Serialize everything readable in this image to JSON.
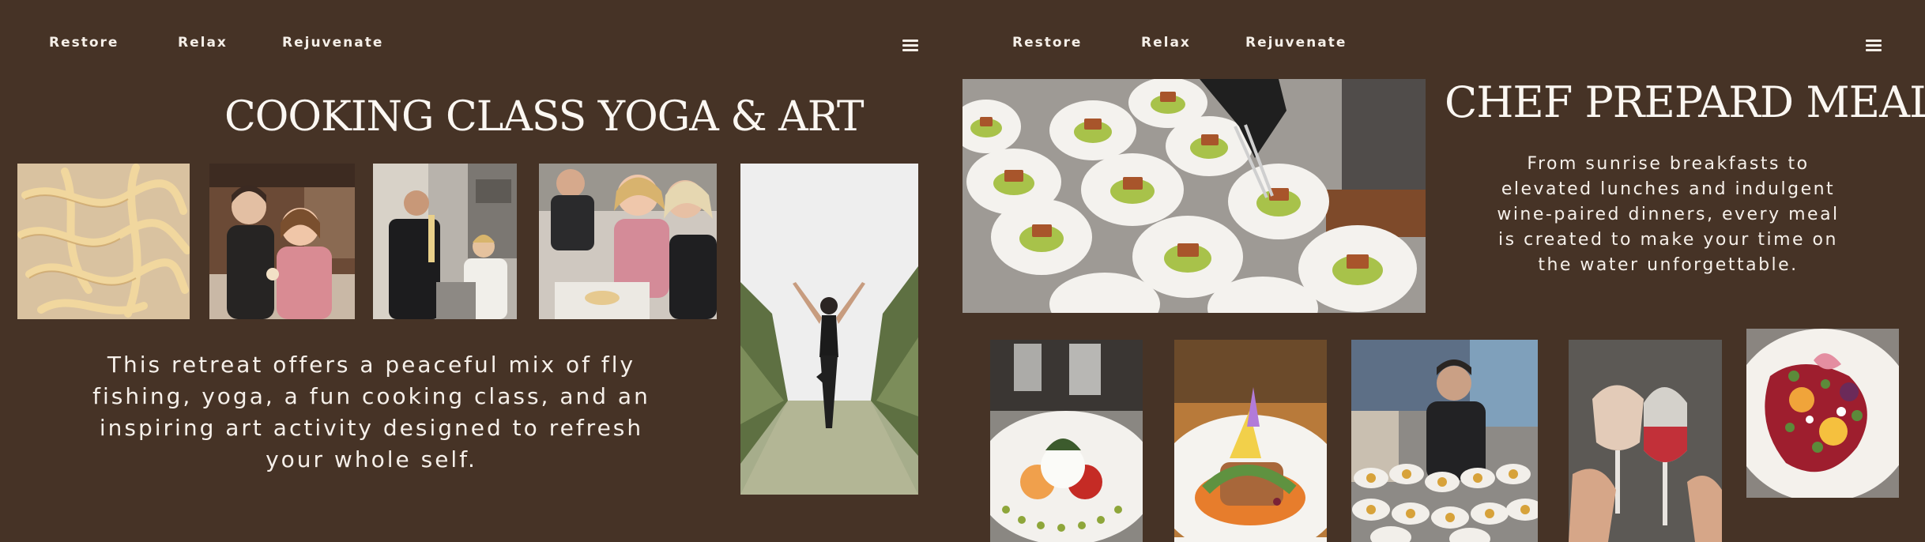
{
  "left": {
    "nav": [
      "Restore",
      "Relax",
      "Rejuvenate"
    ],
    "title": "COOKING CLASS  YOGA & ART",
    "body": "This retreat offers a peaceful mix of fly fishing, yoga, a fun cooking class, and an inspiring art activity designed to refresh your whole self."
  },
  "right": {
    "nav": [
      "Restore",
      "Relax",
      "Rejuvenate"
    ],
    "title": "CHEF PREPARD MEALS",
    "body": "From sunrise breakfasts to elevated lunches and indulgent wine-paired dinners, every meal is created to make your time on the water unforgettable."
  },
  "icons": {
    "menu": "hamburger-menu-icon"
  },
  "colors": {
    "background": "#463326",
    "text": "#f3ede6"
  }
}
